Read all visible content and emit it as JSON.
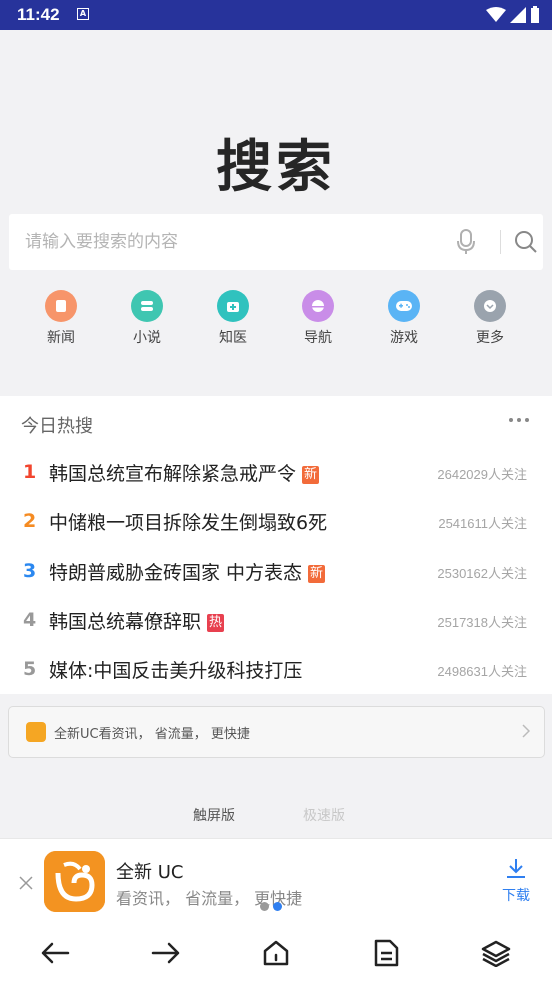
{
  "status_bar": {
    "time": "11:42",
    "notification_badge": "A"
  },
  "logo_title": "搜索",
  "search": {
    "placeholder": "请输入要搜索的内容"
  },
  "quick_nav": [
    {
      "label": "新闻",
      "color": "#f7956a",
      "icon": "news-icon"
    },
    {
      "label": "小说",
      "color": "#3fc6b1",
      "icon": "novel-icon"
    },
    {
      "label": "知医",
      "color": "#30c2be",
      "icon": "medical-icon"
    },
    {
      "label": "导航",
      "color": "#c98de8",
      "icon": "navigation-icon"
    },
    {
      "label": "游戏",
      "color": "#5ab4f5",
      "icon": "game-icon"
    },
    {
      "label": "更多",
      "color": "#9aa3ad",
      "icon": "more-icon"
    }
  ],
  "hot": {
    "title": "今日热搜",
    "items": [
      {
        "rank": "1",
        "text": "韩国总统宣布解除紧急戒严令",
        "tag": "新",
        "count": "2642029人关注",
        "rank_color": "#f2452e",
        "tag_color": "#f26b3a"
      },
      {
        "rank": "2",
        "text": "中储粮一项目拆除发生倒塌致6死",
        "tag": "",
        "count": "2541611人关注",
        "rank_color": "#f58b22",
        "tag_color": ""
      },
      {
        "rank": "3",
        "text": "特朗普威胁金砖国家 中方表态",
        "tag": "新",
        "count": "2530162人关注",
        "rank_color": "#2b88f0",
        "tag_color": "#f26b3a"
      },
      {
        "rank": "4",
        "text": "韩国总统幕僚辞职",
        "tag": "热",
        "count": "2517318人关注",
        "rank_color": "#999999",
        "tag_color": "#e8404f"
      },
      {
        "rank": "5",
        "text": "媒体:中国反击美升级科技打压",
        "tag": "",
        "count": "2498631人关注",
        "rank_color": "#999999",
        "tag_color": ""
      }
    ]
  },
  "promo": {
    "text": "全新UC看资讯， 省流量， 更快捷"
  },
  "version": {
    "touch": "触屏版",
    "fast": "极速版"
  },
  "download_banner": {
    "app_name": "全新 UC",
    "desc": "看资讯， 省流量， 更快捷",
    "download_label": "下载",
    "accent": "#2f7ff0"
  },
  "toolbar": [
    "back-icon",
    "forward-icon",
    "home-icon",
    "pages-icon",
    "layers-icon"
  ]
}
